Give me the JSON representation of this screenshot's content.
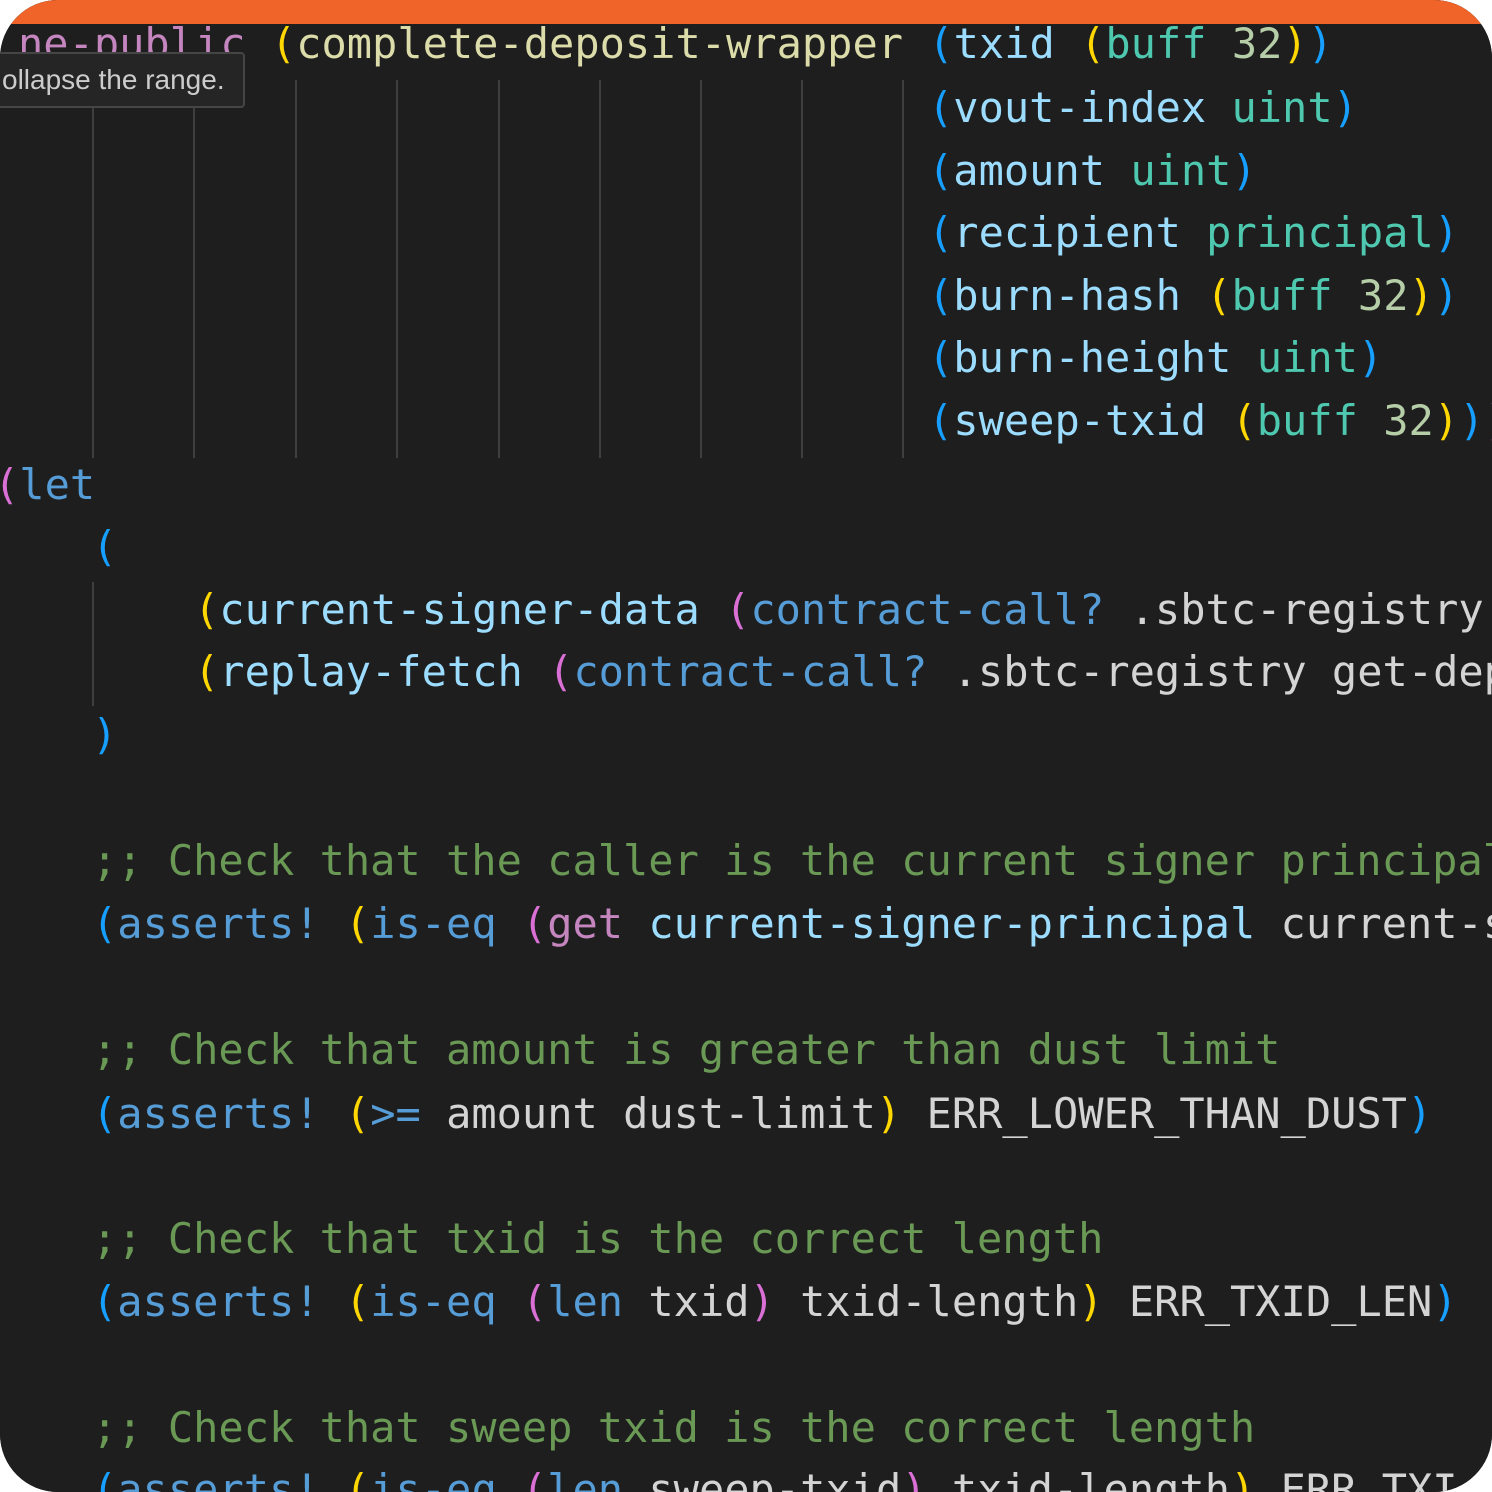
{
  "tooltip": {
    "text": "ollapse the range."
  },
  "code": {
    "l1": {
      "kw": "ne-public",
      "fn": "complete-deposit-wrapper",
      "p": "txid",
      "t": "buff",
      "n": "32"
    },
    "l2": {
      "p": "vout-index",
      "t": "uint"
    },
    "l3": {
      "p": "amount",
      "t": "uint"
    },
    "l4": {
      "p": "recipient",
      "t": "principal"
    },
    "l5": {
      "p": "burn-hash",
      "t": "buff",
      "n": "32"
    },
    "l6": {
      "p": "burn-height",
      "t": "uint"
    },
    "l7": {
      "p": "sweep-txid",
      "t": "buff",
      "n": "32"
    },
    "l8": {
      "kw": "let"
    },
    "l10": {
      "v": "current-signer-data",
      "fn": "contract-call?",
      "rest": ".sbtc-registry"
    },
    "l11": {
      "v": "replay-fetch",
      "fn": "contract-call?",
      "rest": ".sbtc-registry get-dep"
    },
    "c1": "Check that the caller is the current signer principal",
    "a1": {
      "fn": "asserts!",
      "op": "is-eq",
      "get": "get",
      "v": "current-signer-principal",
      "rest": "current-s"
    },
    "c2": "Check that amount is greater than dust limit",
    "a2": {
      "fn": "asserts!",
      "op": ">=",
      "rest": "amount dust-limit",
      "err": "ERR_LOWER_THAN_DUST"
    },
    "c3": "Check that txid is the correct length",
    "a3": {
      "fn": "asserts!",
      "op": "is-eq",
      "len": "len",
      "arg": "txid",
      "rest": "txid-length",
      "err": "ERR_TXID_LEN"
    },
    "c4": "Check that sweep txid is the correct length",
    "a4": {
      "fn": "asserts!",
      "op": "is-eq",
      "len": "len",
      "arg": "sweep-txid",
      "rest": "txid-length",
      "err": "ERR_TXI"
    }
  }
}
